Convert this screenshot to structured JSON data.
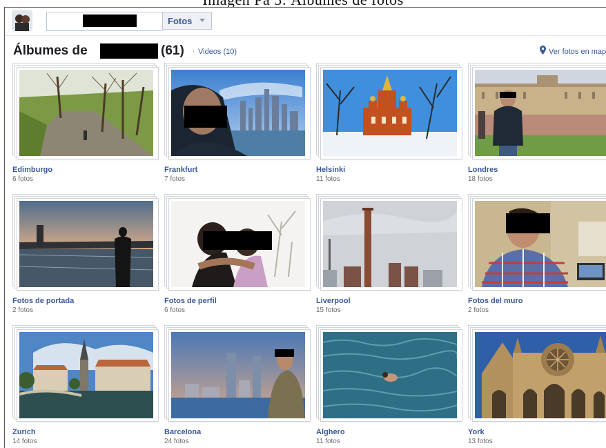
{
  "caption": "Imagen Pa 3: Álbumes de fotos",
  "topbar": {
    "section_button": "Fotos"
  },
  "heading": {
    "title_prefix": "Álbumes de",
    "album_count": "(61)",
    "separator": "·",
    "videos_link": "Videos (10)",
    "map_link": "Ver fotos en mapa"
  },
  "albums": [
    {
      "title": "Edimburgo",
      "count": "6 fotos"
    },
    {
      "title": "Frankfurt",
      "count": "7 fotos"
    },
    {
      "title": "Helsinki",
      "count": "11 fotos"
    },
    {
      "title": "Londres",
      "count": "18 fotos"
    },
    {
      "title": "Fotos de portada",
      "count": "2 fotos"
    },
    {
      "title": "Fotos de perfil",
      "count": "6 fotos"
    },
    {
      "title": "Liverpool",
      "count": "15 fotos"
    },
    {
      "title": "Fotos del muro",
      "count": "2 fotos"
    },
    {
      "title": "Zurich",
      "count": "14 fotos"
    },
    {
      "title": "Barcelona",
      "count": "24 fotos"
    },
    {
      "title": "Alghero",
      "count": "11 fotos"
    },
    {
      "title": "York",
      "count": "13 fotos"
    }
  ],
  "colors": {
    "link": "#3b5998",
    "meta": "#6b6b6b",
    "redaction": "#000000"
  }
}
